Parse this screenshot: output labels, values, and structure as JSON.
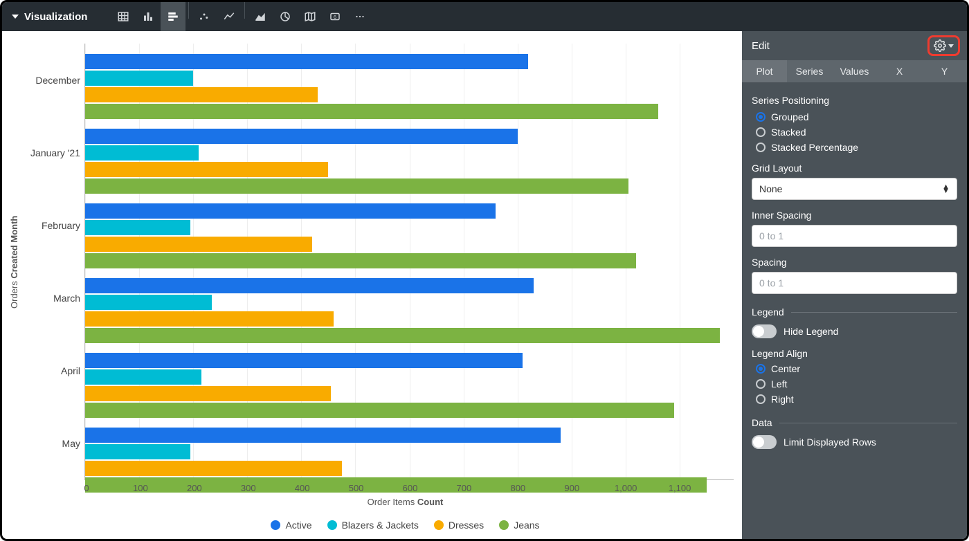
{
  "header": {
    "title": "Visualization"
  },
  "panel": {
    "title": "Edit",
    "tabs": [
      "Plot",
      "Series",
      "Values",
      "X",
      "Y"
    ],
    "active_tab": "Plot",
    "series_positioning": {
      "label": "Series Positioning",
      "options": [
        "Grouped",
        "Stacked",
        "Stacked Percentage"
      ],
      "selected": "Grouped"
    },
    "grid_layout": {
      "label": "Grid Layout",
      "value": "None"
    },
    "inner_spacing": {
      "label": "Inner Spacing",
      "placeholder": "0 to 1"
    },
    "spacing": {
      "label": "Spacing",
      "placeholder": "0 to 1"
    },
    "legend_section": "Legend",
    "hide_legend": {
      "label": "Hide Legend",
      "on": false
    },
    "legend_align": {
      "label": "Legend Align",
      "options": [
        "Center",
        "Left",
        "Right"
      ],
      "selected": "Center"
    },
    "data_section": "Data",
    "limit_rows": {
      "label": "Limit Displayed Rows",
      "on": false
    }
  },
  "chart_data": {
    "type": "bar",
    "orientation": "horizontal",
    "y_axis_prefix": "Orders ",
    "y_axis_bold": "Created Month",
    "x_axis_prefix": "Order Items ",
    "x_axis_bold": "Count",
    "xlim": [
      0,
      1200
    ],
    "xticks": [
      0,
      100,
      200,
      300,
      400,
      500,
      600,
      700,
      800,
      900,
      1000,
      1100
    ],
    "xtick_labels": [
      "0",
      "100",
      "200",
      "300",
      "400",
      "500",
      "600",
      "700",
      "800",
      "900",
      "1,000",
      "1,100"
    ],
    "categories": [
      "December",
      "January '21",
      "February",
      "March",
      "April",
      "May"
    ],
    "series": [
      {
        "name": "Active",
        "color": "#1a73e8",
        "values": [
          820,
          800,
          760,
          830,
          810,
          880
        ]
      },
      {
        "name": "Blazers & Jackets",
        "color": "#00bcd4",
        "values": [
          200,
          210,
          195,
          235,
          215,
          195
        ]
      },
      {
        "name": "Dresses",
        "color": "#f9ab00",
        "values": [
          430,
          450,
          420,
          460,
          455,
          475
        ]
      },
      {
        "name": "Jeans",
        "color": "#7cb342",
        "values": [
          1060,
          1005,
          1020,
          1175,
          1090,
          1150
        ]
      }
    ]
  }
}
